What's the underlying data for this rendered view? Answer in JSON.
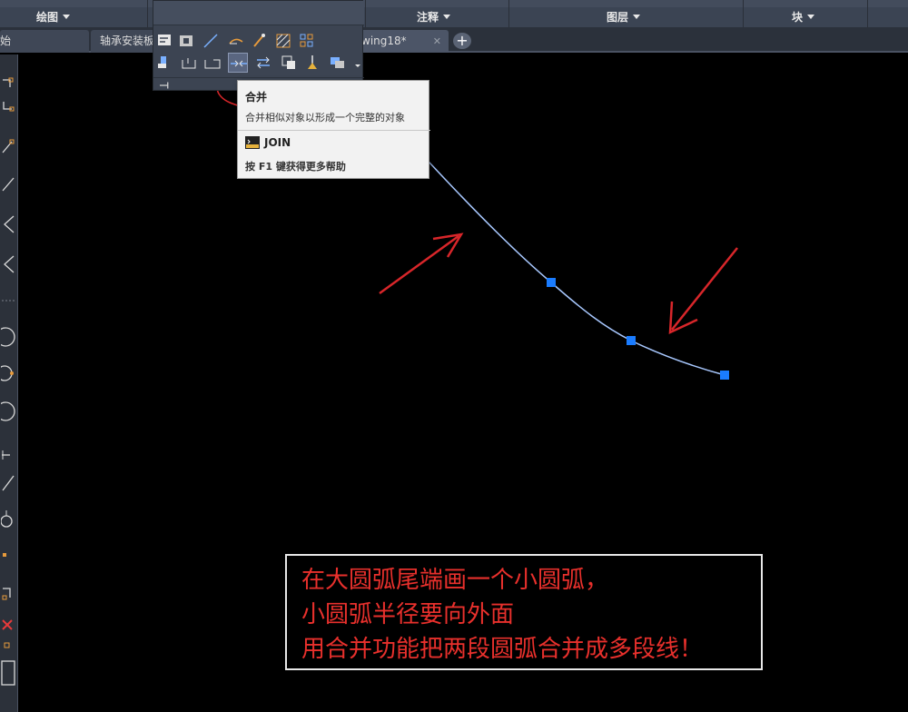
{
  "ribbon": {
    "panels": [
      {
        "label": "绘图"
      },
      {
        "label": "注释"
      },
      {
        "label": "图层"
      },
      {
        "label": "块"
      }
    ]
  },
  "tabs": {
    "items": [
      {
        "label": "始"
      },
      {
        "label": "轴承安装板"
      },
      {
        "label": "wing18*"
      }
    ],
    "close_glyph": "✕",
    "add_glyph": "+"
  },
  "tooltip": {
    "title": "合并",
    "description": "合并相似对象以形成一个完整的对象",
    "command": "JOIN",
    "help": "按 F1 键获得更多帮助"
  },
  "annotation": {
    "lines": [
      "在大圆弧尾端画一个小圆弧，",
      "小圆弧半径要向外面",
      "用合并功能把两段圆弧合并成多段线！"
    ]
  },
  "colors": {
    "canvas_bg": "#000000",
    "arc": "#a8c8ff",
    "grip": "#1a7cff",
    "arrow": "#d8262a",
    "highlight_circle": "#d8262a",
    "annotation_text": "#e8302c"
  },
  "icons": {
    "left_toolbar": [
      "polyline-icon",
      "line-icon",
      "arc-icon",
      "circle-icon",
      "erase-icon"
    ],
    "modify_panel": [
      "join-icon",
      "break-icon",
      "trim-icon",
      "extend-icon"
    ]
  }
}
